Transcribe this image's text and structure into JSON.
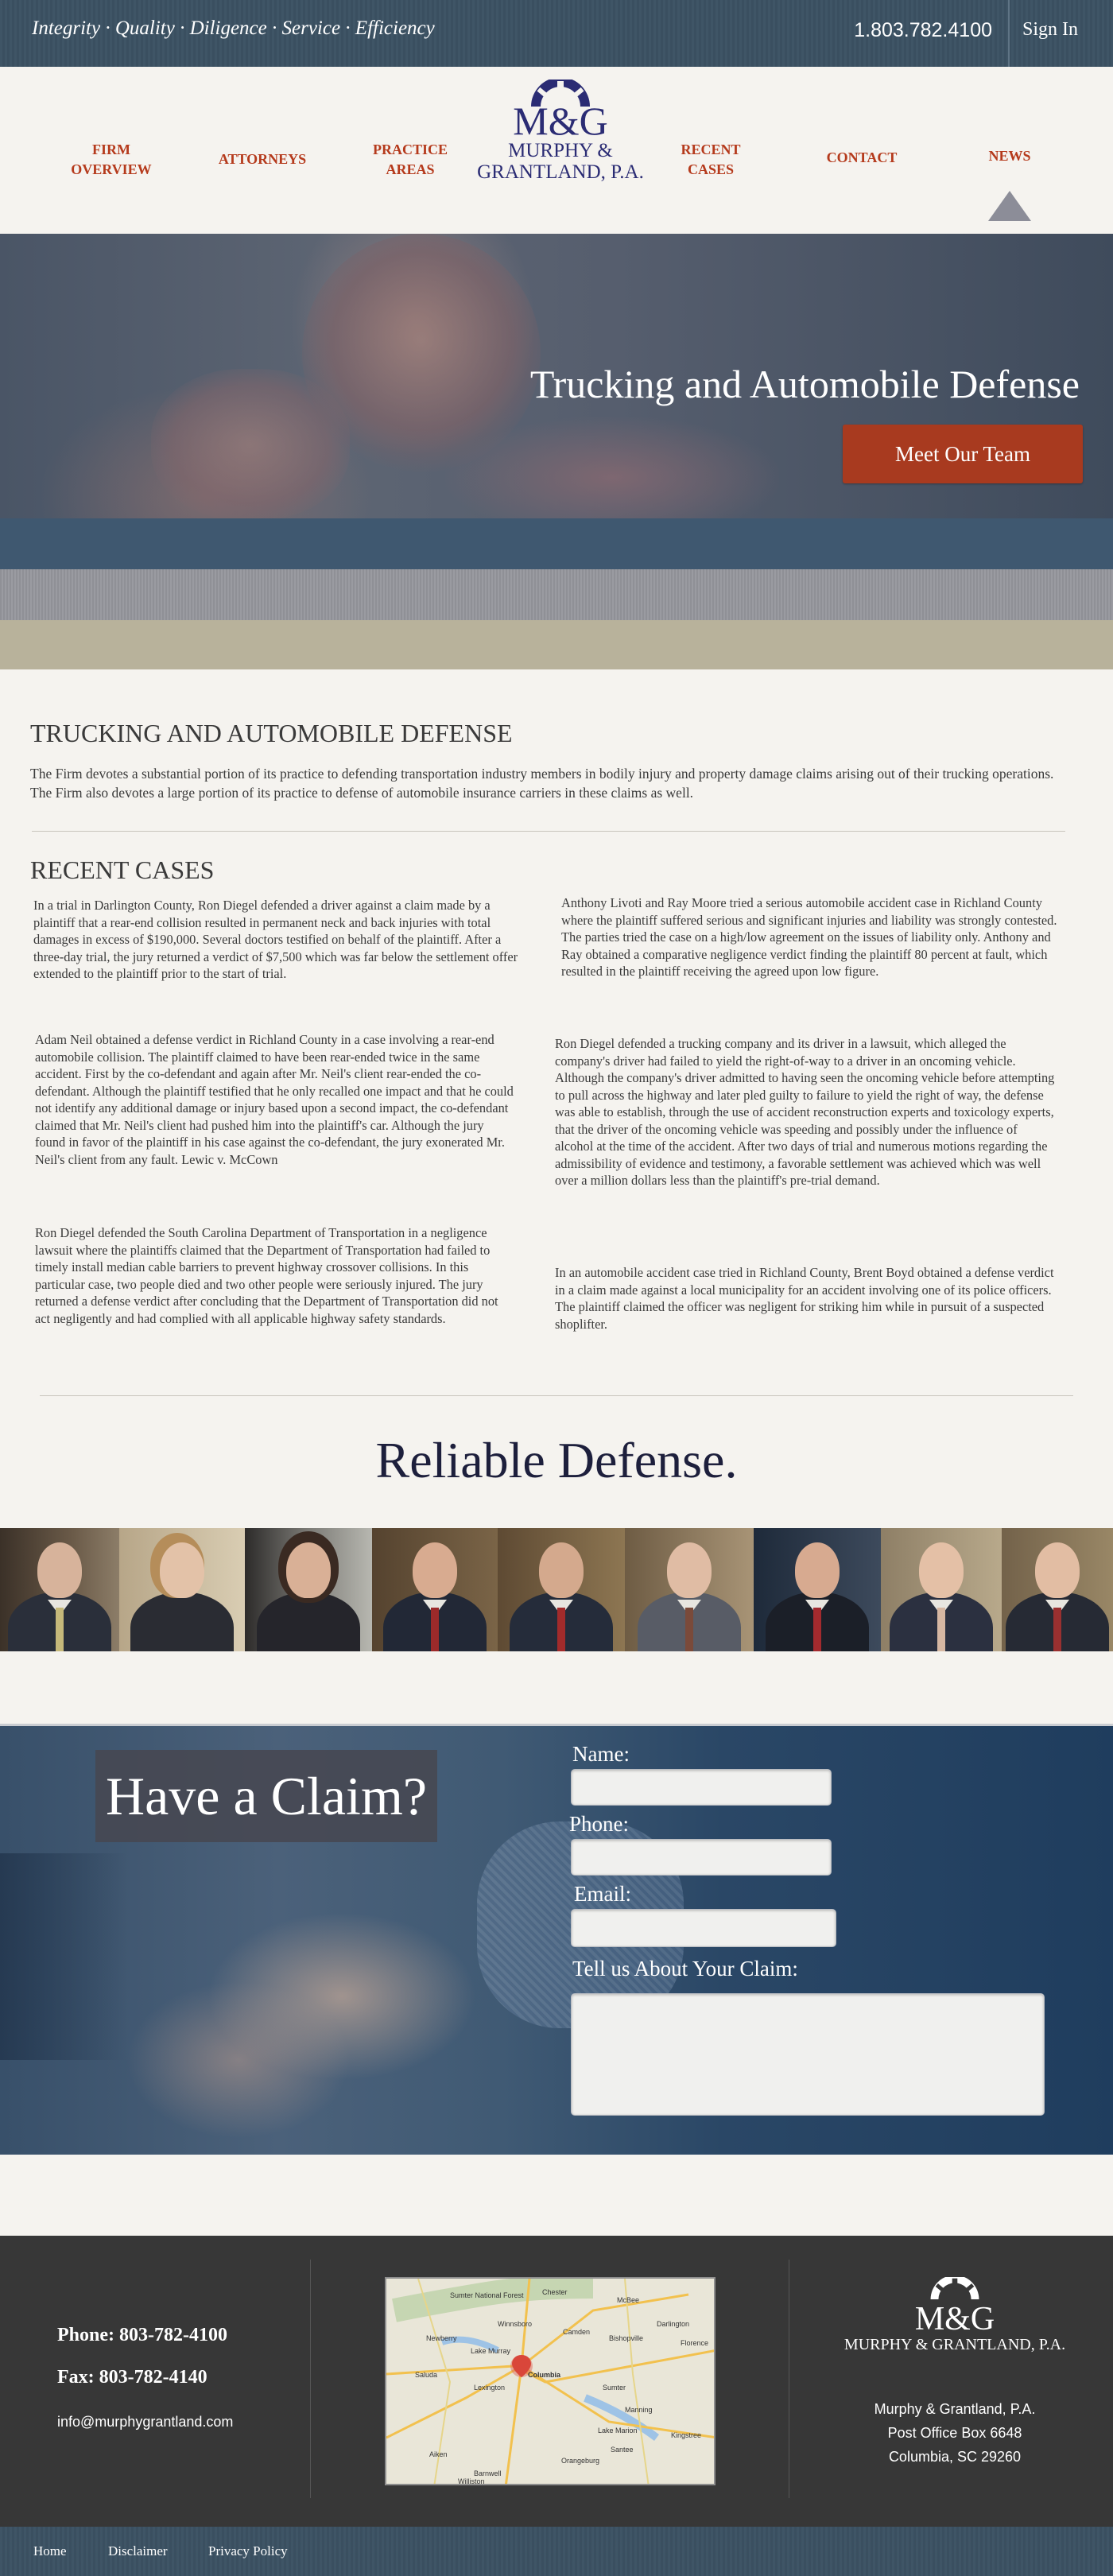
{
  "topbar": {
    "tagline": "Integrity · Quality · Diligence · Service · Efficiency",
    "phone": "1.803.782.4100",
    "signin": "Sign In"
  },
  "nav": {
    "firm_overview": [
      "FIRM",
      "OVERVIEW"
    ],
    "attorneys": "ATTORNEYS",
    "practice_areas": [
      "PRACTICE",
      "AREAS"
    ],
    "recent_cases": [
      "RECENT",
      "CASES"
    ],
    "contact": "CONTACT",
    "news": "NEWS"
  },
  "logo": {
    "mark": "M&G",
    "line1": "MURPHY &",
    "line2": "GRANTLAND, P.A."
  },
  "hero": {
    "title": "Trucking and Automobile Defense",
    "cta": "Meet Our Team"
  },
  "colors": {
    "accent": "#b53a1c",
    "button": "#a83a1f",
    "navy": "#2b2c74",
    "topbar": "#3f5566",
    "footer": "#373737"
  },
  "intro": {
    "heading": "TRUCKING AND AUTOMOBILE DEFENSE",
    "text": "The Firm devotes a substantial portion of its practice to defending transportation industry members in bodily injury and property damage claims arising out of their trucking operations. The Firm also devotes a large portion of its practice to defense of automobile insurance carriers in these claims as well."
  },
  "recent": {
    "heading": "RECENT CASES",
    "cases": [
      "In a trial in Darlington County, Ron Diegel defended a driver against a claim made by a plaintiff that a rear-end collision resulted in permanent neck and back injuries with total damages in excess of $190,000. Several doctors testified on behalf of the plaintiff. After a three-day trial, the jury returned a verdict of $7,500 which was far below the settlement offer extended to the plaintiff prior to the start of trial.",
      "Adam Neil obtained a defense verdict in Richland County in a case involving a rear-end automobile collision.  The plaintiff claimed to have been rear-ended twice in the same accident.  First by the co-defendant and again after Mr. Neil's client rear-ended the co-defendant.  Although the plaintiff testified that he only recalled one impact and that he could not identify any additional damage or injury based upon a second impact, the co-defendant claimed that Mr. Neil's client had pushed him into the plaintiff's car.  Although the jury found in favor of the plaintiff in his case against the co-defendant, the jury exonerated Mr. Neil's client from any fault.  Lewic v. McCown",
      "Ron Diegel defended the South Carolina Department of Transportation in a negligence lawsuit where the plaintiffs claimed that the Department of Transportation had failed to timely install median cable barriers to prevent highway crossover collisions. In this particular case, two people died and two other people were seriously injured. The jury returned a defense verdict after concluding that the Department of Transportation did not act negligently and had complied with all applicable highway safety standards.",
      "Anthony Livoti and Ray Moore tried a serious automobile accident case in Richland County where the plaintiff suffered serious and significant injuries and liability was strongly contested. The parties tried the case on a high/low agreement on the issues of liability only. Anthony and Ray obtained a comparative negligence verdict finding the plaintiff 80 percent at fault, which resulted in the plaintiff receiving the agreed upon low figure.",
      "Ron Diegel defended a trucking company and its driver in a lawsuit, which alleged the company's driver had failed to yield the right-of-way to a driver in an oncoming vehicle. Although the company's driver admitted to having seen the oncoming vehicle before attempting to pull across the highway and later pled guilty to failure to yield the right of way, the defense was able to establish, through the use of accident reconstruction experts and toxicology experts, that the driver of the oncoming vehicle was speeding and possibly under the influence of alcohol at the time of the accident. After two days of trial and numerous motions regarding the admissibility of evidence and testimony, a favorable settlement was achieved which was well over a million dollars less than the plaintiff's pre-trial demand.",
      "In an automobile accident case tried in Richland County, Brent Boyd obtained a defense verdict in a claim made against a local municipality for an accident involving one of its police officers. The plaintiff claimed the officer was negligent for striking him while in pursuit of a suspected shoplifter."
    ]
  },
  "reliable": "Reliable Defense.",
  "claim": {
    "title": "Have a Claim?",
    "name_label": "Name:",
    "phone_label": "Phone:",
    "email_label": "Email:",
    "about_label": "Tell us About Your Claim:"
  },
  "footer": {
    "phone": "Phone:  803-782-4100",
    "fax": "Fax:  803-782-4140",
    "email": "info@murphygrantland.com",
    "logo_mark": "M&G",
    "logo_name": "MURPHY & GRANTLAND, P.A.",
    "address": [
      "Murphy & Grantland, P.A.",
      "Post Office Box 6648",
      "Columbia, SC 29260"
    ],
    "map_labels": [
      "Sumter National Forest",
      "Columbia",
      "Camden",
      "Bishopville",
      "Darlington",
      "Florence",
      "Sumter",
      "Lexington",
      "Newberry",
      "Winnsboro",
      "Chester",
      "Orangeburg",
      "Aiken",
      "Saluda",
      "Lake Murray",
      "Manning",
      "Kingstree",
      "McBee",
      "Lake Marion",
      "Santee",
      "Barnwell",
      "Williston"
    ]
  },
  "bottom_links": [
    "Home",
    "Disclaimer",
    "Privacy Policy"
  ]
}
